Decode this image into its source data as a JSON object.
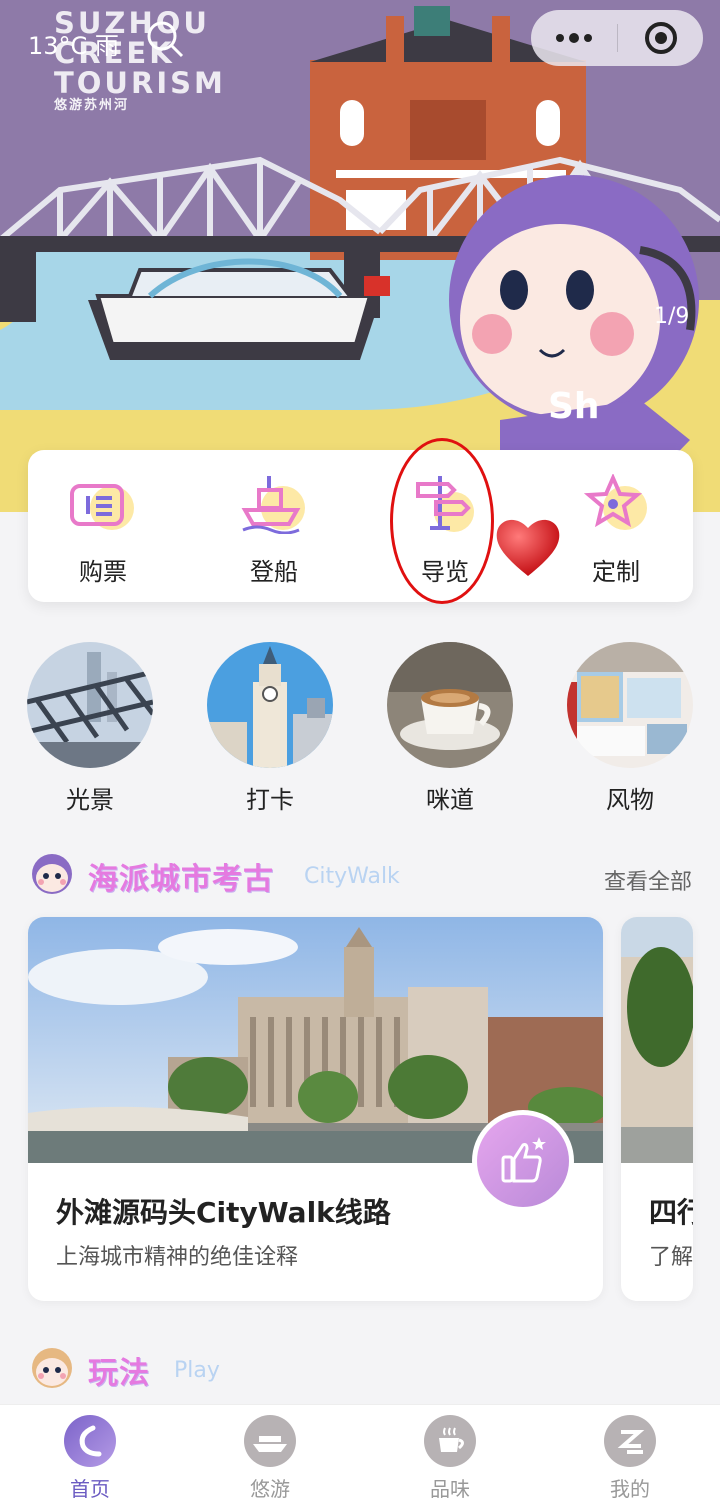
{
  "status": {
    "weather": "13°C 雨"
  },
  "hero": {
    "logo_lines": [
      "SUZHOU",
      "CREEK",
      "TOURISM"
    ],
    "logo_sub": "悠游苏州河",
    "pager": "1/9",
    "brand_color": "#8e7aa8"
  },
  "quick_menu": [
    {
      "label": "购票",
      "icon": "ticket-icon"
    },
    {
      "label": "登船",
      "icon": "boat-icon"
    },
    {
      "label": "导览",
      "icon": "signpost-icon"
    },
    {
      "label": "定制",
      "icon": "star-icon"
    }
  ],
  "categories": [
    {
      "label": "光景",
      "icon": "bridge-photo"
    },
    {
      "label": "打卡",
      "icon": "clocktower-photo"
    },
    {
      "label": "咪道",
      "icon": "coffee-photo"
    },
    {
      "label": "风物",
      "icon": "souvenir-photo"
    }
  ],
  "citywalk": {
    "title": "海派城市考古",
    "en": "CityWalk",
    "more": "查看全部",
    "cards": [
      {
        "title": "外滩源码头CityWalk线路",
        "subtitle": "上海城市精神的绝佳诠释"
      },
      {
        "title": "四行",
        "subtitle": "了解"
      }
    ]
  },
  "play": {
    "title": "玩法",
    "en": "Play"
  },
  "tabs": [
    {
      "label": "首页",
      "icon": "home-icon",
      "active": true
    },
    {
      "label": "悠游",
      "icon": "ship-icon",
      "active": false
    },
    {
      "label": "品味",
      "icon": "cup-icon",
      "active": false
    },
    {
      "label": "我的",
      "icon": "profile-icon",
      "active": false
    }
  ],
  "colors": {
    "accent": "#6b5bc2",
    "section_title": "#e57ae0",
    "annotation": "#e01010"
  }
}
